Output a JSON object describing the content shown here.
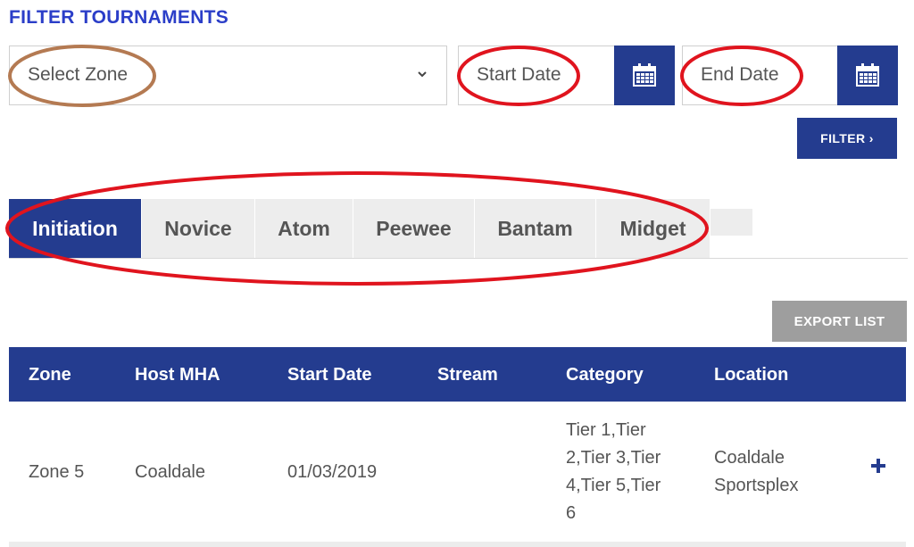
{
  "filter": {
    "title": "FILTER TOURNAMENTS",
    "zone_placeholder": "Select Zone",
    "start_date_placeholder": "Start Date",
    "end_date_placeholder": "End Date",
    "filter_button": "FILTER ›"
  },
  "tabs": [
    {
      "label": "Initiation",
      "active": true
    },
    {
      "label": "Novice",
      "active": false
    },
    {
      "label": "Atom",
      "active": false
    },
    {
      "label": "Peewee",
      "active": false
    },
    {
      "label": "Bantam",
      "active": false
    },
    {
      "label": "Midget",
      "active": false
    }
  ],
  "export_button": "EXPORT LIST",
  "table": {
    "headers": [
      "Zone",
      "Host MHA",
      "Start Date",
      "Stream",
      "Category",
      "Location"
    ],
    "rows": [
      {
        "zone": "Zone 5",
        "host": "Coaldale",
        "start_date": "01/03/2019",
        "stream": "",
        "category_lines": [
          "Tier 1,Tier",
          "2,Tier 3,Tier",
          "4,Tier 5,Tier",
          "6"
        ],
        "location_lines": [
          "Coaldale",
          "Sportsplex"
        ]
      }
    ]
  },
  "colors": {
    "primary": "#243c8f",
    "title": "#2b3ec8",
    "annotation_red": "#e0141e",
    "annotation_brown": "#b47a52",
    "tab_inactive": "#ededed",
    "export": "#9e9e9e"
  },
  "icons": [
    "chevron-down-icon",
    "calendar-icon",
    "plus-icon"
  ]
}
